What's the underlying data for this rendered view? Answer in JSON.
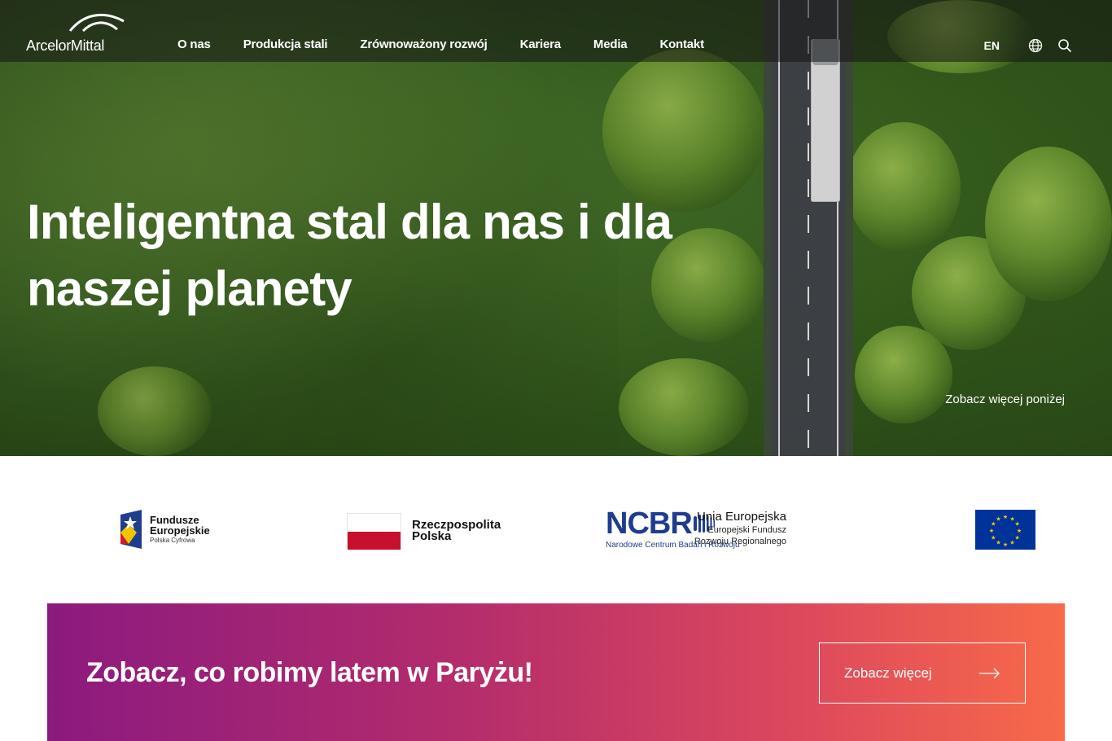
{
  "header": {
    "logo_text": "ArcelorMittal",
    "nav": [
      {
        "label": "O nas"
      },
      {
        "label": "Produkcja stali"
      },
      {
        "label": "Zrównoważony rozwój"
      },
      {
        "label": "Kariera"
      },
      {
        "label": "Media"
      },
      {
        "label": "Kontakt"
      }
    ],
    "lang": "EN",
    "icons": [
      "globe-icon",
      "search-icon"
    ]
  },
  "hero": {
    "title": "Inteligentna stal dla nas i dla naszej planety",
    "see_more": "Zobacz więcej poniżej"
  },
  "logos": {
    "fe": {
      "line1": "Fundusze",
      "line2": "Europejskie",
      "line3": "Polska Cyfrowa"
    },
    "rp": {
      "line1": "Rzeczpospolita",
      "line2": "Polska"
    },
    "ncbr": {
      "word": "NCBR",
      "sub": "Narodowe Centrum Badań i Rozwoju"
    },
    "ue": {
      "line1": "Unia Europejska",
      "line2": "Europejski Fundusz",
      "line3": "Rozwoju Regionalnego"
    }
  },
  "banner": {
    "title": "Zobacz, co robimy latem w Paryżu!",
    "button": "Zobacz więcej"
  },
  "colors": {
    "banner_start": "#8b1a7f",
    "banner_end": "#f86a49",
    "ncbr_blue": "#1e3d8f",
    "eu_blue": "#003399",
    "eu_star": "#ffcc00",
    "poland_red": "#c8102e"
  }
}
